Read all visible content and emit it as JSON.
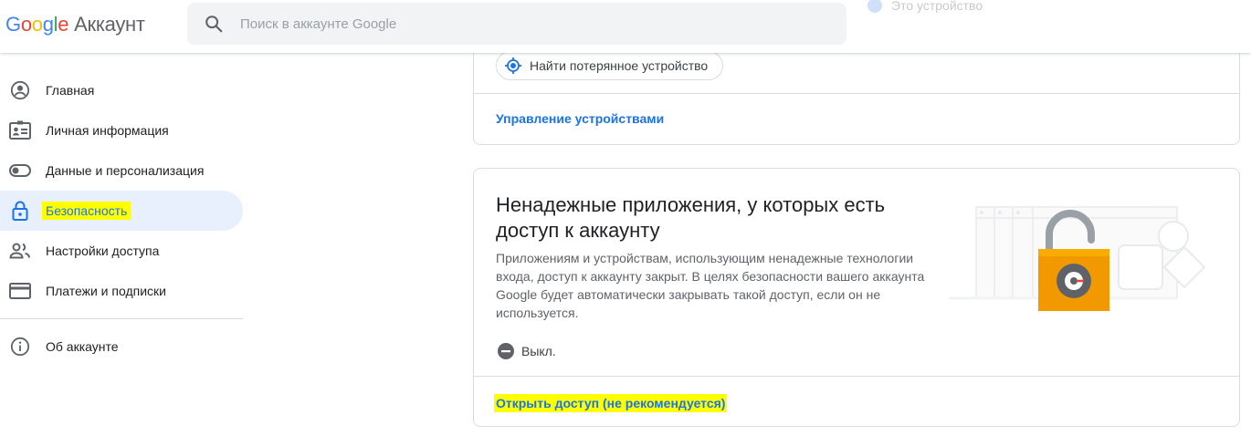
{
  "header": {
    "logo": {
      "g1": "G",
      "g2": "o",
      "g3": "o",
      "g4": "g",
      "g5": "l",
      "g6": "e",
      "product": "Аккаунт"
    },
    "search": {
      "placeholder": "Поиск в аккаунте Google",
      "icon": "search-icon"
    },
    "ghost_label": "Это устройство"
  },
  "sidebar": {
    "items": [
      {
        "label": "Главная",
        "icon": "account-circle-icon"
      },
      {
        "label": "Личная информация",
        "icon": "id-card-icon"
      },
      {
        "label": "Данные и персонализация",
        "icon": "toggle-icon"
      },
      {
        "label": "Безопасность",
        "icon": "lock-icon",
        "active": true
      },
      {
        "label": "Настройки доступа",
        "icon": "people-icon"
      },
      {
        "label": "Платежи и подписки",
        "icon": "credit-card-icon"
      }
    ],
    "about": {
      "label": "Об аккаунте",
      "icon": "info-icon"
    }
  },
  "devices_card": {
    "find_device_label": "Найти потерянное устройство",
    "manage_link": "Управление устройствами"
  },
  "less_secure_card": {
    "title": "Ненадежные приложения, у которых есть доступ к аккаунту",
    "description": "Приложениям и устройствам, использующим ненадежные технологии входа, доступ к аккаунту закрыт. В целях безопасности вашего аккаунта Google будет автоматически закрывать такой доступ, если он не используется.",
    "status": "Выкл.",
    "enable_link": "Открыть доступ (не рекомендуется)"
  },
  "colors": {
    "accent": "#1a73e8",
    "highlight": "#ffff00",
    "lock_orange": "#f29900"
  }
}
